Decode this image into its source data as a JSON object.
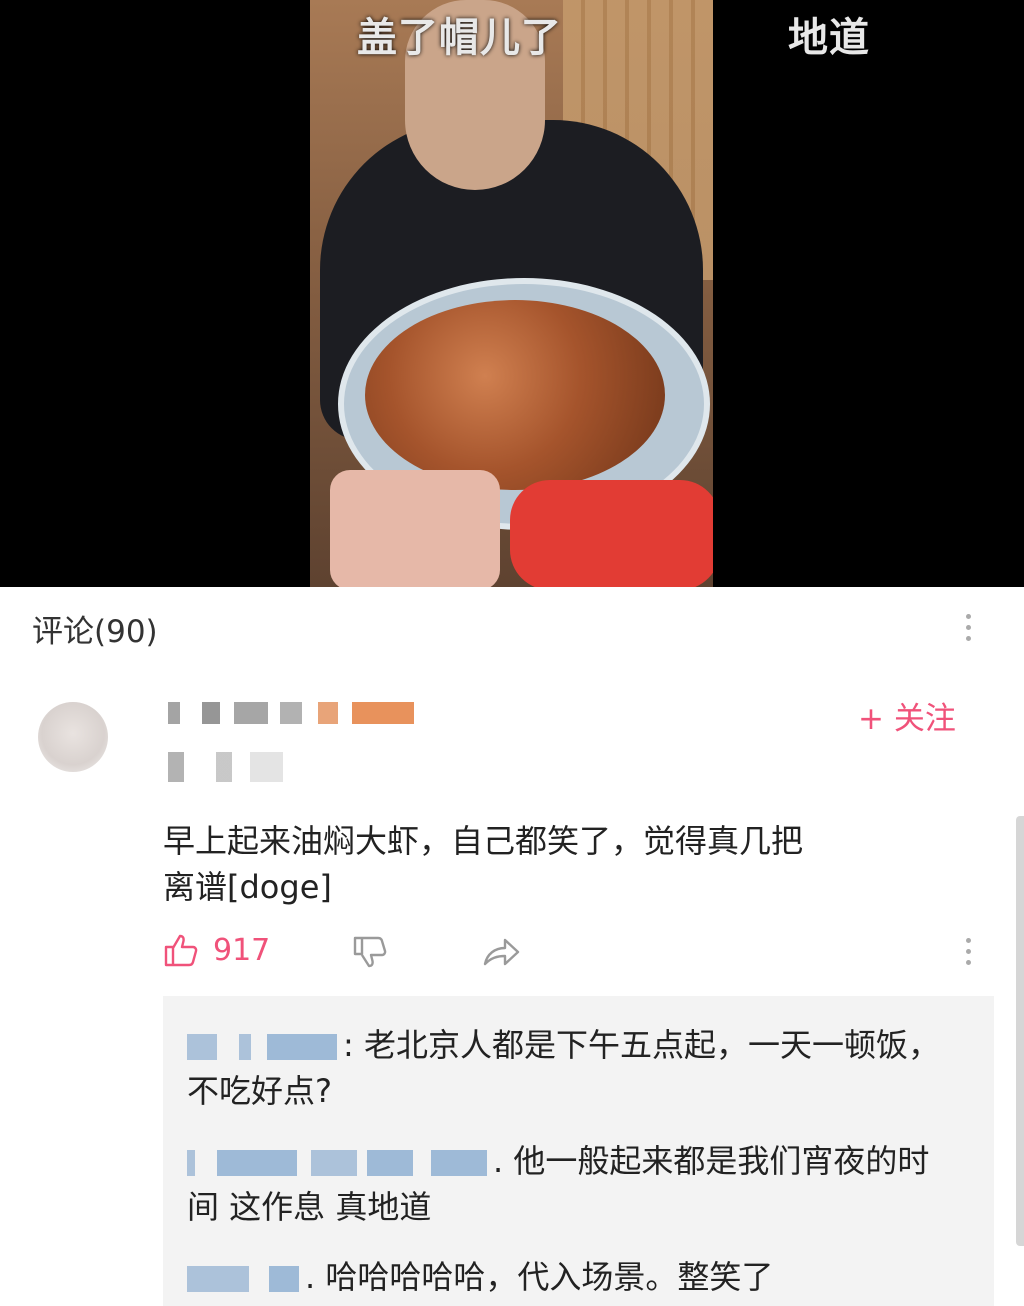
{
  "video": {
    "overlay_left": "盖了帽儿了",
    "overlay_right": "地道"
  },
  "comments": {
    "title": "评论(90)",
    "main": {
      "follow_label": "+ 关注",
      "text": "早上起来油焖大虾，自己都笑了，觉得真几把离谱[doge]",
      "likes": "917"
    },
    "replies": [
      {
        "text": ": 老北京人都是下午五点起，一天一顿饭，不吃好点?"
      },
      {
        "text": ". 他一般起来都是我们宵夜的时间 这作息 真地道"
      },
      {
        "text": ". 哈哈哈哈哈，代入场景。整笑了"
      }
    ]
  },
  "colors": {
    "accent": "#f0527a",
    "reply_bg": "#f3f3f3",
    "video_bg": "#000000"
  }
}
